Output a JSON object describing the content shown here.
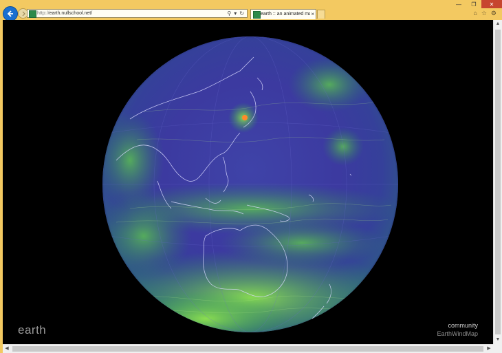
{
  "browser": {
    "url_scheme": "http://",
    "url_host": "earth.nullschool.net/",
    "tab_title": "earth :: an animated map ...",
    "tab_close": "×",
    "address_icons": [
      "search-icon",
      "dropdown-icon",
      "refresh-icon"
    ],
    "window_controls": [
      "minimize",
      "maximize",
      "close"
    ],
    "toolbar_icons": [
      "home-icon",
      "favorites-icon",
      "settings-icon"
    ]
  },
  "page": {
    "brand": "earth",
    "community_link": "community",
    "ewm_link": "EarthWindMap"
  },
  "colors": {
    "ocean": "#3c3aa0",
    "wind_high": "#7fd94a",
    "coastline": "#c8c8ff",
    "background": "#000000"
  }
}
